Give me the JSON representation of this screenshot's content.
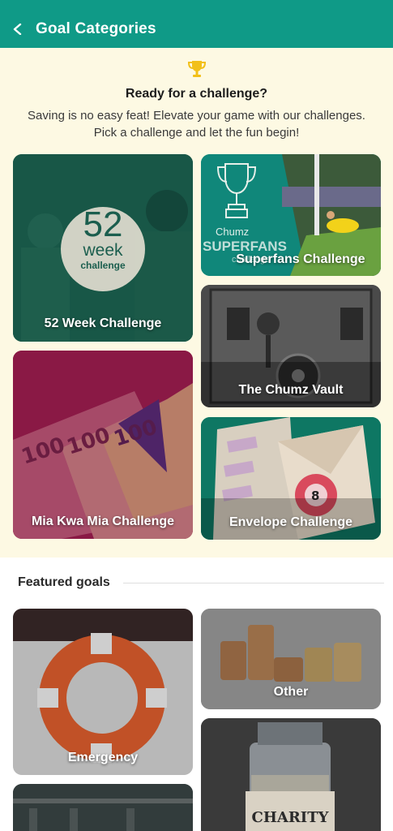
{
  "header": {
    "title": "Goal Categories",
    "back_icon": "chevron-left-icon",
    "color": "#0f9a87"
  },
  "challenge": {
    "title": "Ready for a challenge?",
    "desc_line1": "Saving is no easy feat! Elevate your game with our challenges.",
    "desc_line2": "Pick a challenge and let the fun begin!",
    "icon": "trophy-icon",
    "cards": {
      "week52": {
        "label": "52 Week Challenge",
        "badge_number": "52",
        "badge_word": "week",
        "badge_sub": "challenge"
      },
      "superfans": {
        "label": "Superfans Challenge",
        "logo_word": "Chumz",
        "logo_big": "SUPERFANS",
        "logo_sub": "challenge"
      },
      "vault": {
        "label": "The Chumz Vault"
      },
      "miakwamia": {
        "label": "Mia Kwa Mia Challenge"
      },
      "envelope": {
        "label": "Envelope Challenge"
      }
    }
  },
  "featured": {
    "title": "Featured goals",
    "cards": {
      "emergency": {
        "label": "Emergency"
      },
      "other": {
        "label": "Other"
      },
      "charity": {
        "label": "",
        "jar_text": "CHARITY"
      }
    }
  }
}
